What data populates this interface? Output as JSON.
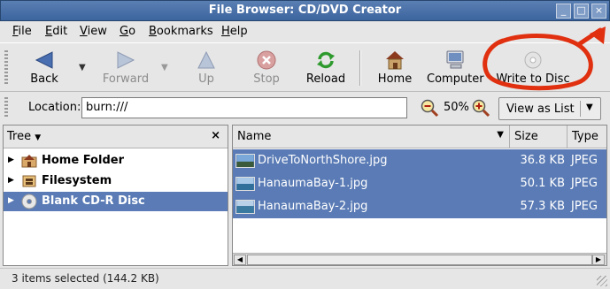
{
  "window": {
    "title": "File Browser: CD/DVD Creator",
    "controls": [
      "_",
      "□",
      "×"
    ]
  },
  "menubar": [
    {
      "first": "F",
      "rest": "ile"
    },
    {
      "first": "E",
      "rest": "dit"
    },
    {
      "first": "V",
      "rest": "iew"
    },
    {
      "first": "G",
      "rest": "o"
    },
    {
      "first": "B",
      "rest": "ookmarks"
    },
    {
      "first": "H",
      "rest": "elp"
    }
  ],
  "toolbar": {
    "back": "Back",
    "forward": "Forward",
    "up": "Up",
    "stop": "Stop",
    "reload": "Reload",
    "home": "Home",
    "computer": "Computer",
    "write": "Write to Disc"
  },
  "location": {
    "label": "Location:",
    "value": "burn:///",
    "zoom": "50%",
    "view_mode": "View as List"
  },
  "tree": {
    "selector": "Tree",
    "close": "×",
    "items": [
      {
        "label": "Home Folder",
        "icon": "home-folder-icon",
        "selected": false
      },
      {
        "label": "Filesystem",
        "icon": "filesystem-icon",
        "selected": false
      },
      {
        "label": "Blank CD-R Disc",
        "icon": "cd-disc-icon",
        "selected": true
      }
    ]
  },
  "columns": {
    "name": "Name",
    "size": "Size",
    "type": "Type"
  },
  "files": [
    {
      "name": "DriveToNorthShore.jpg",
      "size": "36.8 KB",
      "type": "JPEG"
    },
    {
      "name": "HanaumaBay-1.jpg",
      "size": "50.1 KB",
      "type": "JPEG"
    },
    {
      "name": "HanaumaBay-2.jpg",
      "size": "57.3 KB",
      "type": "JPEG"
    }
  ],
  "status": "3 items selected (144.2 KB)",
  "colors": {
    "selection": "#5a7bb5",
    "titlebar": "#3c649e",
    "annotation": "#e03010"
  }
}
